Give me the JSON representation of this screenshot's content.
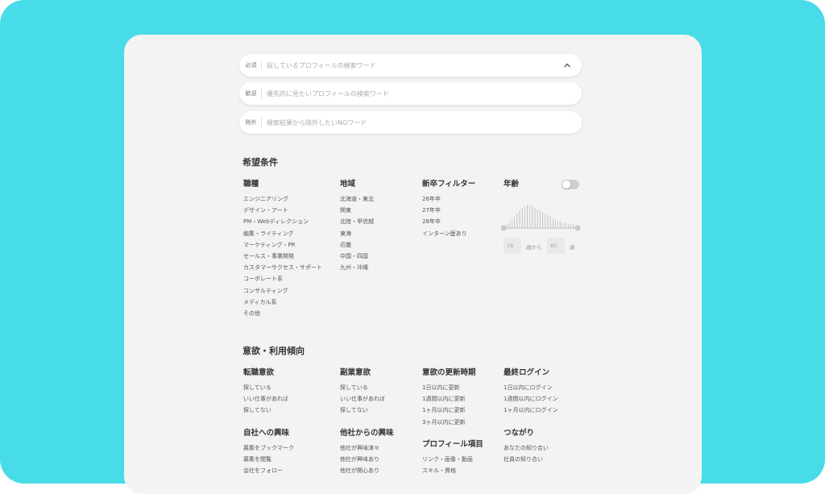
{
  "search": [
    {
      "tag": "必須",
      "placeholder": "探しているプロフィールの検索ワード"
    },
    {
      "tag": "歓迎",
      "placeholder": "優先的に見たいプロフィールの検索ワード"
    },
    {
      "tag": "除外",
      "placeholder": "検索結果から除外したいNGワード"
    }
  ],
  "conditions": {
    "heading": "希望条件",
    "job": {
      "title": "職種",
      "items": [
        "エンジニアリング",
        "デザイン・アート",
        "PM・Webディレクション",
        "編集・ライティング",
        "マーケティング・PR",
        "セールス・事業開発",
        "カスタマーサクセス・サポート",
        "コーポレート系",
        "コンサルティング",
        "メディカル系",
        "その他"
      ]
    },
    "region": {
      "title": "地域",
      "items": [
        "北海道・東北",
        "関東",
        "北陸・甲信越",
        "東海",
        "近畿",
        "中国・四国",
        "九州・沖縄"
      ]
    },
    "newgrad": {
      "title": "新卒フィルター",
      "items": [
        "26年卒",
        "27年卒",
        "28年卒",
        "インターン歴あり"
      ]
    },
    "age": {
      "title": "年齢",
      "min": "18",
      "from": "歳から",
      "max": "60",
      "unit": "歳"
    }
  },
  "motivation": {
    "heading": "意欲・利用傾向",
    "change": {
      "title": "転職意欲",
      "items": [
        "探している",
        "いい仕事があれば",
        "探してない"
      ]
    },
    "side": {
      "title": "副業意欲",
      "items": [
        "探している",
        "いい仕事があれば",
        "探してない"
      ]
    },
    "updated": {
      "title": "意欲の更新時期",
      "items": [
        "1日以内に更新",
        "1週間以内に更新",
        "1ヶ月以内に更新",
        "3ヶ月以内に更新"
      ]
    },
    "login": {
      "title": "最終ログイン",
      "items": [
        "1日以内にログイン",
        "1週間以内にログイン",
        "1ヶ月以内にログイン"
      ]
    },
    "interest": {
      "title": "自社への興味",
      "items": [
        "募集をブックマーク",
        "募集を閲覧",
        "会社をフォロー"
      ]
    },
    "others": {
      "title": "他社からの興味",
      "items": [
        "他社が興味津々",
        "他社が興味あり",
        "他社が関心あり"
      ]
    },
    "profile": {
      "title": "プロフィール項目",
      "items": [
        "リンク・画像・動画",
        "スキル・資格"
      ]
    },
    "connect": {
      "title": "つながり",
      "items": [
        "あなたの知り合い",
        "社員の知り合い"
      ]
    }
  },
  "colors": {
    "background": "#48dbe8",
    "panel": "#f3f3f3",
    "toggle_off": "#cfcfcf"
  },
  "age_histogram": [
    2,
    3,
    5,
    7,
    9,
    11,
    13,
    14,
    15,
    15,
    14,
    13,
    12,
    11,
    10,
    9,
    8,
    7,
    6,
    5,
    4,
    4,
    3,
    3,
    2,
    2,
    2,
    1
  ]
}
